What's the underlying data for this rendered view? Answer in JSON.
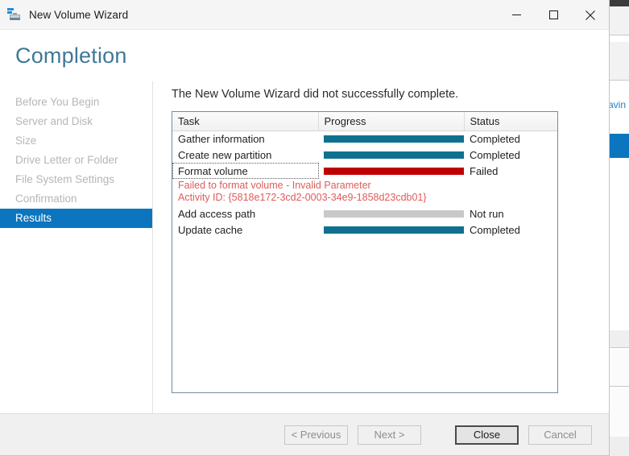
{
  "window": {
    "title": "New Volume Wizard",
    "icon": "volume-wizard-icon",
    "controls": {
      "minimize": "minimize-icon",
      "maximize": "maximize-icon",
      "close": "close-icon"
    }
  },
  "page": {
    "title": "Completion",
    "heading": "The New Volume Wizard did not successfully complete."
  },
  "sidebar": {
    "items": [
      {
        "label": "Before You Begin",
        "active": false
      },
      {
        "label": "Server and Disk",
        "active": false
      },
      {
        "label": "Size",
        "active": false
      },
      {
        "label": "Drive Letter or Folder",
        "active": false
      },
      {
        "label": "File System Settings",
        "active": false
      },
      {
        "label": "Confirmation",
        "active": false
      },
      {
        "label": "Results",
        "active": true
      }
    ]
  },
  "results_table": {
    "columns": [
      "Task",
      "Progress",
      "Status"
    ],
    "rows": [
      {
        "task": "Gather information",
        "progress": 100,
        "bar": "teal",
        "status": "Completed",
        "focused": false
      },
      {
        "task": "Create new partition",
        "progress": 100,
        "bar": "teal",
        "status": "Completed",
        "focused": false
      },
      {
        "task": "Format volume",
        "progress": 100,
        "bar": "red",
        "status": "Failed",
        "focused": true
      },
      {
        "task": "Add access path",
        "progress": 100,
        "bar": "gray",
        "status": "Not run",
        "focused": false
      },
      {
        "task": "Update cache",
        "progress": 100,
        "bar": "teal",
        "status": "Completed",
        "focused": false
      }
    ],
    "error": {
      "line1": "Failed to format volume - Invalid Parameter",
      "line2": "Activity ID: {5818e172-3cd2-0003-34e9-1858d23cdb01}"
    }
  },
  "footer": {
    "previous": "< Previous",
    "next": "Next >",
    "close": "Close",
    "cancel": "Cancel"
  },
  "background": {
    "partial_text": "avin"
  },
  "colors": {
    "accent_blue": "#0b76bf",
    "title_teal": "#3f7995",
    "progress_teal": "#10708f",
    "progress_red": "#c00000",
    "progress_gray": "#c9c9c9",
    "error_red": "#e05b5b",
    "panel_border": "#6f8ba4"
  }
}
